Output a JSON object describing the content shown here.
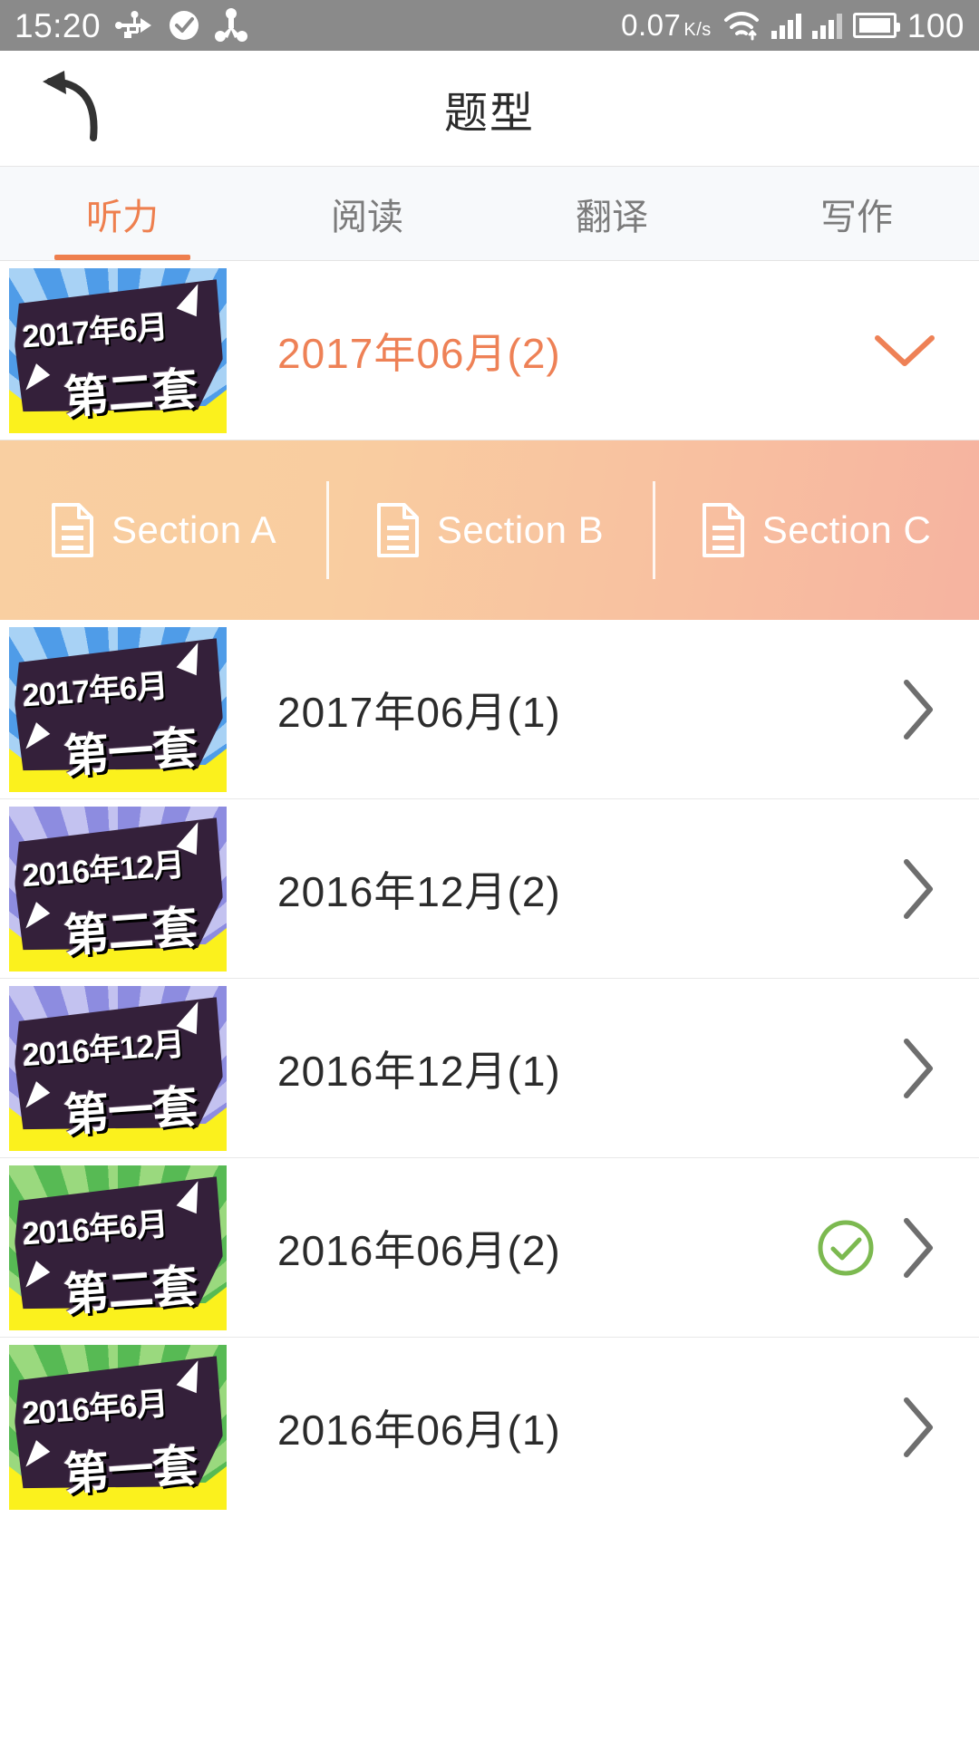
{
  "statusbar": {
    "time": "15:20",
    "icons_left": [
      "usb-icon",
      "check-circle-icon",
      "node-share-icon"
    ],
    "network_speed": "0.07",
    "network_speed_unit": "K/s",
    "icons_right": [
      "wifi-icon",
      "signal-bars-icon",
      "signal-bars-icon-2",
      "battery-icon"
    ],
    "battery_level": "100"
  },
  "titlebar": {
    "back_icon": "back-arrow-icon",
    "title": "题型"
  },
  "tabs": [
    {
      "label": "听力",
      "active": true
    },
    {
      "label": "阅读",
      "active": false
    },
    {
      "label": "翻译",
      "active": false
    },
    {
      "label": "写作",
      "active": false
    }
  ],
  "sections": [
    {
      "label": "Section A",
      "icon": "document-icon"
    },
    {
      "label": "Section B",
      "icon": "document-icon"
    },
    {
      "label": "Section C",
      "icon": "document-icon"
    }
  ],
  "list": [
    {
      "label": "2017年06月(2)",
      "expanded": true,
      "completed": false,
      "thumb": {
        "line1": "2017年6月",
        "line2": "第二套",
        "theme": "blue"
      }
    },
    {
      "label": "2017年06月(1)",
      "expanded": false,
      "completed": false,
      "thumb": {
        "line1": "2017年6月",
        "line2": "第一套",
        "theme": "blue"
      }
    },
    {
      "label": "2016年12月(2)",
      "expanded": false,
      "completed": false,
      "thumb": {
        "line1": "2016年12月",
        "line2": "第二套",
        "theme": "purple"
      }
    },
    {
      "label": "2016年12月(1)",
      "expanded": false,
      "completed": false,
      "thumb": {
        "line1": "2016年12月",
        "line2": "第一套",
        "theme": "purple"
      }
    },
    {
      "label": "2016年06月(2)",
      "expanded": false,
      "completed": true,
      "thumb": {
        "line1": "2016年6月",
        "line2": "第二套",
        "theme": "green"
      }
    },
    {
      "label": "2016年06月(1)",
      "expanded": false,
      "completed": false,
      "thumb": {
        "line1": "2016年6月",
        "line2": "第一套",
        "theme": "green"
      }
    }
  ],
  "colors": {
    "accent_orange": "#ee7f4e",
    "row_label_orange": "#ee8156",
    "complete_green": "#7cb950",
    "chevron_gray": "#6e6e6e",
    "statusbar_gray": "#8a8a8a",
    "tabbar_bg": "#f7f9fb",
    "section_gradient_start": "#f9cfa1",
    "section_gradient_end": "#f6b3a0"
  }
}
